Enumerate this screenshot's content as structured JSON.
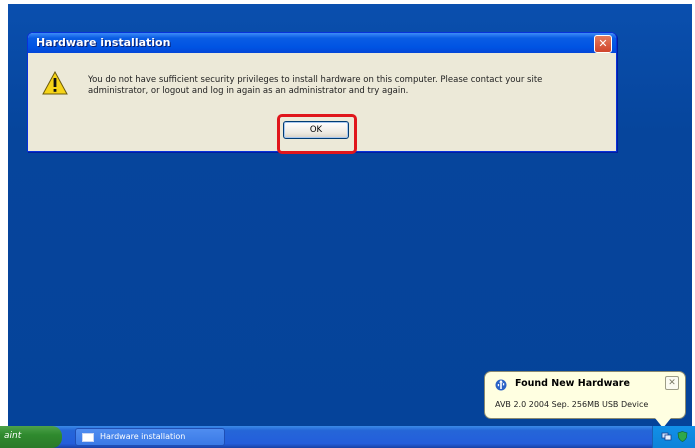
{
  "dialog": {
    "title": "Hardware installation",
    "close_symbol": "✕",
    "icon": "warning-icon",
    "message": "You do not have sufficient security privileges to install hardware on this computer. Please contact your site administrator, or logout and log in again as an administrator and try again.",
    "ok_label": "OK",
    "highlight_color": "#e0161c"
  },
  "notification": {
    "icon": "usb-icon",
    "title": "Found New Hardware",
    "body": "AVB 2.0 2004 Sep. 256MB USB Device",
    "close_symbol": "✕"
  },
  "taskbar": {
    "start_fragment": "aint",
    "task_label": "Hardware installation",
    "task_icon": "window-icon",
    "tray_icons": [
      "network-icon",
      "shield-icon"
    ]
  },
  "colors": {
    "desktop": "#06459c",
    "titlebar": "#0054e3",
    "dialog_bg": "#ece9d8",
    "balloon_bg": "#ffffe1"
  }
}
